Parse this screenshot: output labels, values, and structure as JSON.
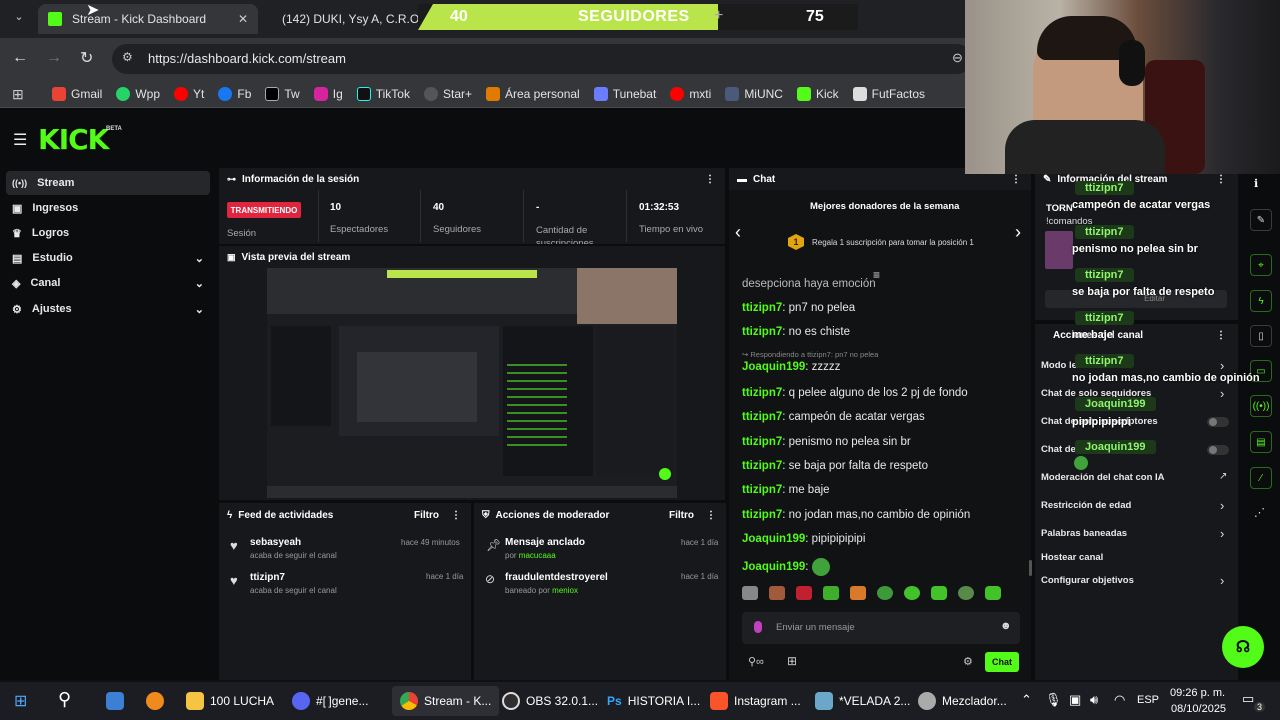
{
  "browser": {
    "tabs": [
      {
        "title": "Stream - Kick Dashboard"
      },
      {
        "title": "(142) DUKI, Ysy A, C.R.O - "
      }
    ],
    "url": "https://dashboard.kick.com/stream",
    "bookmarks": [
      "Gmail",
      "Wpp",
      "Yt",
      "Fb",
      "Tw",
      "Ig",
      "TikTok",
      "Star+",
      "Área personal",
      "Tunebat",
      "mxti",
      "MiUNC",
      "Kick",
      "FutFactos"
    ]
  },
  "overlay": {
    "followers_count": "40",
    "followers_label": "SEGUIDORES",
    "goal": "75"
  },
  "kick": {
    "logo": "KICK",
    "beta": "BETA",
    "sidebar": [
      {
        "label": "Stream"
      },
      {
        "label": "Ingresos"
      },
      {
        "label": "Logros"
      },
      {
        "label": "Estudio"
      },
      {
        "label": "Canal"
      },
      {
        "label": "Ajustes"
      }
    ]
  },
  "session": {
    "title": "Información de la sesión",
    "status": "TRANSMITIENDO",
    "status_label": "Sesión",
    "stats": [
      {
        "value": "10",
        "label": "Espectadores"
      },
      {
        "value": "40",
        "label": "Seguidores"
      },
      {
        "value": "-",
        "label": "Cantidad de suscripciones"
      },
      {
        "value": "01:32:53",
        "label": "Tiempo en vivo"
      }
    ],
    "preview_title": "Vista previa del stream"
  },
  "feed": {
    "title": "Feed de actividades",
    "filter": "Filtro",
    "items": [
      {
        "user": "sebasyeah",
        "action": "acaba de seguir el canal",
        "time": "hace 49 minutos"
      },
      {
        "user": "ttizipn7",
        "action": "acaba de seguir el canal",
        "time": "hace 1 día"
      }
    ]
  },
  "mod": {
    "title": "Acciones de moderador",
    "filter": "Filtro",
    "items": [
      {
        "action": "Mensaje anclado",
        "by_prefix": "por",
        "by": "macucaaa",
        "time": "hace 1 día"
      },
      {
        "action": "fraudulentdestroyerel",
        "by_prefix": "baneado por",
        "by": "meniox",
        "time": "hace 1 día"
      }
    ]
  },
  "chat": {
    "title": "Chat",
    "top_title": "Mejores donadores de la semana",
    "top_rank": "1",
    "top_text": "Regala 1 suscripción para tomar la posición 1",
    "cut_line": "desepciona haya emoción",
    "reply_note": "Respondiendo a ttizipn7: pn7 no pelea",
    "messages": [
      {
        "user": "ttizipn7",
        "text": "pn7 no pelea"
      },
      {
        "user": "ttizipn7",
        "text": "no es chiste"
      },
      {
        "user": "Joaquin199",
        "text": "zzzzz"
      },
      {
        "user": "ttizipn7",
        "text": "q pelee alguno de los 2 pj de fondo"
      },
      {
        "user": "ttizipn7",
        "text": "campeón de acatar vergas"
      },
      {
        "user": "ttizipn7",
        "text": "penismo no pelea sin br"
      },
      {
        "user": "ttizipn7",
        "text": "se baja por falta de respeto"
      },
      {
        "user": "ttizipn7",
        "text": "me baje"
      },
      {
        "user": "ttizipn7",
        "text": "no jodan mas,no cambio de opinión"
      },
      {
        "user": "Joaquin199",
        "text": "pipipipipipi"
      },
      {
        "user": "Joaquin199",
        "text": ""
      }
    ],
    "placeholder": "Enviar un mensaje",
    "send": "Chat"
  },
  "right": {
    "title": "Información del stream",
    "title_prefix": "TORN",
    "sub": "!comandos",
    "edit": "Editar",
    "section2": "Acciones del canal",
    "rows": [
      {
        "label": "Modo lento"
      },
      {
        "label": "Chat de solo seguidores"
      },
      {
        "label": "Chat de solo suscriptores"
      },
      {
        "label": "Chat de emotes"
      },
      {
        "label": "Moderación del chat con IA"
      },
      {
        "label": "Restricción de edad"
      },
      {
        "label": "Palabras baneadas"
      },
      {
        "label": "Hostear canal"
      },
      {
        "label": "Configurar objetivos"
      }
    ]
  },
  "overlay_chat": [
    {
      "user": "ttizipn7",
      "text": "campeón de acatar vergas"
    },
    {
      "user": "ttizipn7",
      "text": "penismo no pelea sin br"
    },
    {
      "user": "ttizipn7",
      "text": "se baja por falta de respeto"
    },
    {
      "user": "ttizipn7",
      "text": "me baje"
    },
    {
      "user": "ttizipn7",
      "text": "no jodan mas,no cambio de opinión"
    },
    {
      "user": "Joaquin199",
      "text": "pipipipipipi"
    },
    {
      "user": "Joaquin199",
      "text": ""
    }
  ],
  "taskbar": {
    "items": [
      "100 LUCHA",
      "#[ ]gene...",
      "Stream - K...",
      "OBS 32.0.1...",
      "HISTORIA I...",
      "Instagram ...",
      "*VELADA 2...",
      "Mezclador..."
    ],
    "lang": "ESP",
    "time": "09:26 p. m.",
    "date": "08/10/2025",
    "notif": "3"
  },
  "colors": {
    "kick_green": "#53fc18",
    "live_red": "#e0263f",
    "panel": "#17181b"
  }
}
